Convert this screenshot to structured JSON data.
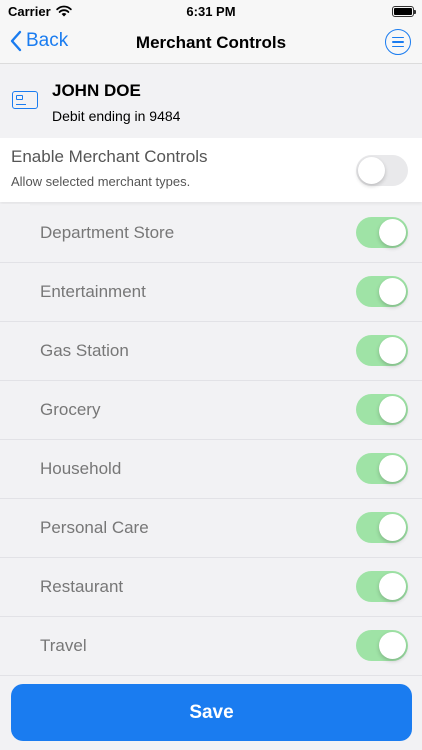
{
  "status_bar": {
    "carrier": "Carrier",
    "time": "6:31 PM"
  },
  "nav": {
    "back_label": "Back",
    "title": "Merchant Controls",
    "accent_color": "#1a7cf0"
  },
  "card": {
    "name": "JOHN DOE",
    "subtitle": "Debit ending in 9484"
  },
  "enable": {
    "title": "Enable Merchant Controls",
    "subtitle": "Allow selected merchant types.",
    "enabled": false
  },
  "merchants": [
    {
      "label": "Department Store",
      "enabled": true
    },
    {
      "label": "Entertainment",
      "enabled": true
    },
    {
      "label": "Gas Station",
      "enabled": true
    },
    {
      "label": "Grocery",
      "enabled": true
    },
    {
      "label": "Household",
      "enabled": true
    },
    {
      "label": "Personal Care",
      "enabled": true
    },
    {
      "label": "Restaurant",
      "enabled": true
    },
    {
      "label": "Travel",
      "enabled": true
    }
  ],
  "save_label": "Save"
}
